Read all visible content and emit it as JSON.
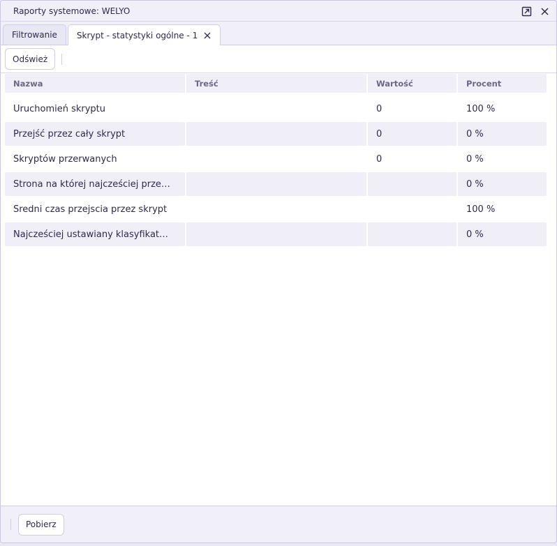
{
  "window": {
    "title": "Raporty systemowe: WELYO"
  },
  "tabs": [
    {
      "label": "Filtrowanie"
    },
    {
      "label": "Skrypt - statystyki ogólne - 1"
    }
  ],
  "toolbar": {
    "refresh_label": "Odśwież"
  },
  "table": {
    "columns": [
      "Nazwa",
      "Treść",
      "Wartość",
      "Procent"
    ],
    "rows": [
      {
        "nazwa": "Uruchomień skryptu",
        "tresc": "",
        "wartosc": "0",
        "procent": "100 %"
      },
      {
        "nazwa": "Przejść przez cały skrypt",
        "tresc": "",
        "wartosc": "0",
        "procent": "0 %"
      },
      {
        "nazwa": "Skryptów przerwanych",
        "tresc": "",
        "wartosc": "0",
        "procent": "0 %"
      },
      {
        "nazwa": "Strona na której najcześciej prze…",
        "tresc": "",
        "wartosc": "",
        "procent": "0 %"
      },
      {
        "nazwa": "Średni czas przejscia przez skrypt",
        "tresc": "",
        "wartosc": "",
        "procent": "100 %"
      },
      {
        "nazwa": "Najcześciej ustawiany klasyfikat…",
        "tresc": "",
        "wartosc": "",
        "procent": "0 %"
      }
    ]
  },
  "footer": {
    "download_label": "Pobierz"
  },
  "icons": {
    "popout": "popout-icon",
    "close": "close-icon",
    "tab_close": "tab-close-icon"
  },
  "colors": {
    "accent": "#2e2a4a",
    "header_bg": "#f1f0f8",
    "row_alt": "#f0eff7"
  }
}
